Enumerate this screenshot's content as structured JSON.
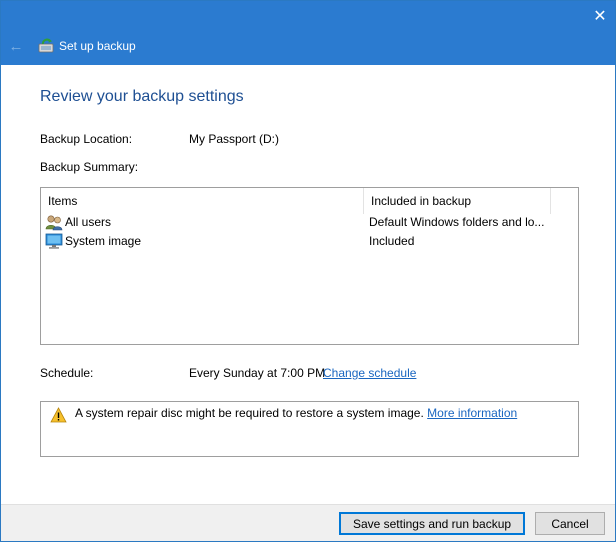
{
  "window": {
    "title": "Set up backup",
    "close_glyph": "✕",
    "back_glyph": "←"
  },
  "page": {
    "heading": "Review your backup settings"
  },
  "backup_location": {
    "label": "Backup Location:",
    "value": "My Passport (D:)"
  },
  "backup_summary": {
    "label": "Backup Summary:",
    "columns": [
      "Items",
      "Included in backup"
    ],
    "rows": [
      {
        "item": "All users",
        "icon": "users-icon",
        "included": "Default Windows folders and lo..."
      },
      {
        "item": "System image",
        "icon": "monitor-icon",
        "included": "Included"
      }
    ]
  },
  "schedule": {
    "label": "Schedule:",
    "value": "Every Sunday at 7:00 PM",
    "link": "Change schedule"
  },
  "warning": {
    "icon": "warning-icon",
    "text": "A system repair disc might be required to restore a system image.",
    "link": "More information"
  },
  "buttons": {
    "save": "Save settings and run backup",
    "cancel": "Cancel"
  },
  "colors": {
    "titlebar": "#2b7bd0",
    "heading": "#1e4f93",
    "link": "#1a66c0"
  }
}
